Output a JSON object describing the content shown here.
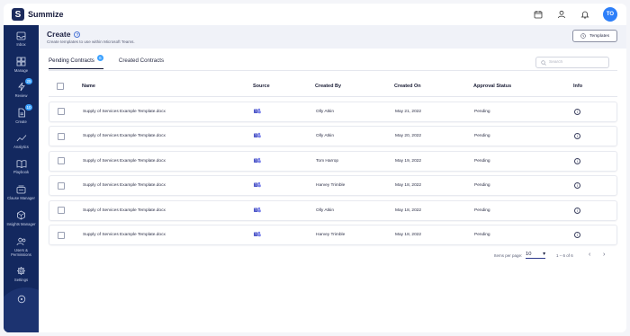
{
  "app": {
    "name": "Summize",
    "logo_letter": "S"
  },
  "topbar": {
    "icons": [
      "calendar-icon",
      "person-icon",
      "bell-icon"
    ],
    "avatar_initials": "TO"
  },
  "sidebar": {
    "items": [
      {
        "label": "Inbox",
        "icon": "inbox-icon",
        "badge": ""
      },
      {
        "label": "Manage",
        "icon": "grid-icon",
        "badge": ""
      },
      {
        "label": "Review",
        "icon": "bolt-icon",
        "badge": "25"
      },
      {
        "label": "Create",
        "icon": "document-icon",
        "badge": "10"
      },
      {
        "label": "Analytics",
        "icon": "chart-line-icon",
        "badge": ""
      },
      {
        "label": "Playbook",
        "icon": "book-icon",
        "badge": ""
      },
      {
        "label": "Clause Manager",
        "icon": "clause-icon",
        "badge": ""
      },
      {
        "label": "Insights Manager",
        "icon": "hexagon-icon",
        "badge": ""
      },
      {
        "label": "Users & Permissions",
        "icon": "users-icon",
        "badge": ""
      },
      {
        "label": "Settings",
        "icon": "gear-icon",
        "badge": ""
      },
      {
        "label": "",
        "icon": "help-icon",
        "badge": ""
      }
    ]
  },
  "header": {
    "title": "Create",
    "subtitle": "Create templates to use within Microsoft Teams.",
    "templates_button": "Templates"
  },
  "tabs": [
    {
      "label": "Pending Contracts",
      "badge": "6",
      "active": true
    },
    {
      "label": "Created Contracts",
      "badge": "",
      "active": false
    }
  ],
  "search": {
    "placeholder": "Search"
  },
  "table": {
    "columns": [
      "Name",
      "Source",
      "Created By",
      "Created On",
      "Approval Status",
      "Info"
    ],
    "rows": [
      {
        "name": "Supply of Services Example Template.docx",
        "source": "teams-icon",
        "created_by": "Olly Atkin",
        "created_on": "May 21, 2022",
        "status": "Pending"
      },
      {
        "name": "Supply of Services Example Template.docx",
        "source": "teams-icon",
        "created_by": "Olly Atkin",
        "created_on": "May 20, 2022",
        "status": "Pending"
      },
      {
        "name": "Supply of Services Example Template.docx",
        "source": "teams-icon",
        "created_by": "Tom Harrop",
        "created_on": "May 19, 2022",
        "status": "Pending"
      },
      {
        "name": "Supply of Services Example Template.docx",
        "source": "teams-icon",
        "created_by": "Harvey Trimble",
        "created_on": "May 18, 2022",
        "status": "Pending"
      },
      {
        "name": "Supply of Services Example Template.docx",
        "source": "teams-icon",
        "created_by": "Olly Atkin",
        "created_on": "May 18, 2022",
        "status": "Pending"
      },
      {
        "name": "Supply of Services Example Template.docx",
        "source": "teams-icon",
        "created_by": "Harvey Trimble",
        "created_on": "May 18, 2022",
        "status": "Pending"
      }
    ]
  },
  "pagination": {
    "items_per_page_label": "Items per page:",
    "items_per_page": "10",
    "range": "1 – 6 of 6"
  },
  "colors": {
    "sidebar": "#13285f",
    "accent": "#3da2ff",
    "teams": "#5059c9"
  }
}
